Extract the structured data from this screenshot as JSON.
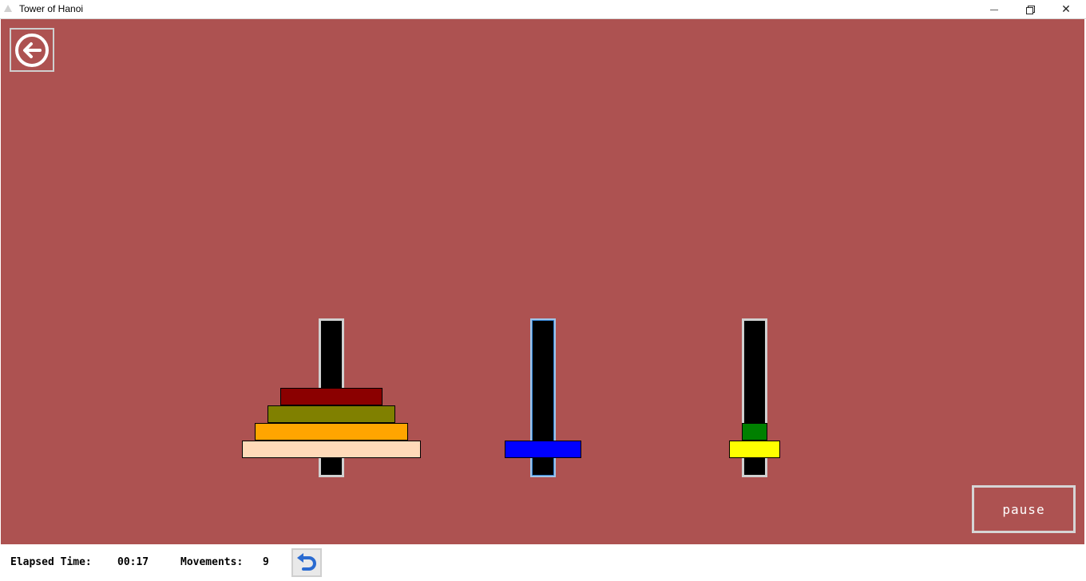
{
  "window": {
    "title": "Tower of Hanoi",
    "icons": {
      "app": "app-icon",
      "minimize": "minimize-icon",
      "maximize": "restore-icon",
      "close": "close-icon"
    },
    "close_glyph": "✕"
  },
  "game": {
    "background": "#ad5251",
    "back_button_icon": "back-arrow-icon",
    "pause_label": "pause",
    "selected_pole": "middle",
    "poles": [
      {
        "name": "left",
        "disks_bottom_to_top": [
          {
            "size": 4,
            "color": "#ffdab9"
          },
          {
            "size": 3,
            "color": "#ffa500"
          },
          {
            "size": 2,
            "color": "#808000"
          },
          {
            "size": 1,
            "color": "#8b0000"
          }
        ]
      },
      {
        "name": "middle",
        "disks_bottom_to_top": [
          {
            "size": 3,
            "color": "#0000ff"
          }
        ]
      },
      {
        "name": "right",
        "disks_bottom_to_top": [
          {
            "size": 4,
            "color": "#ffff00"
          },
          {
            "size": 1,
            "color": "#008000"
          }
        ]
      }
    ]
  },
  "status": {
    "elapsed_label": "Elapsed Time:",
    "elapsed_value": "00:17",
    "movements_label": "Movements:",
    "movements_value": "9",
    "undo_icon": "undo-icon"
  }
}
